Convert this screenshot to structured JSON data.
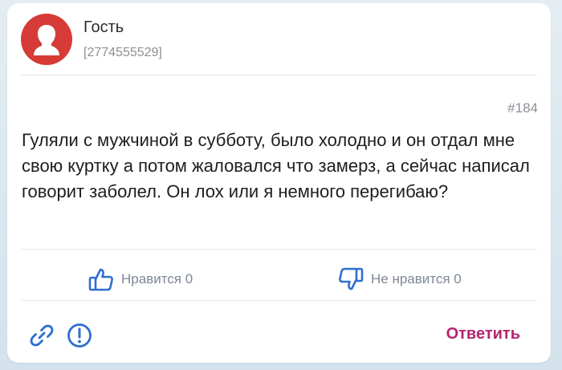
{
  "author": {
    "name": "Гость",
    "id": "[2774555529]",
    "avatar_icon": "user-silhouette-icon",
    "avatar_color": "#d63b37"
  },
  "post": {
    "number": "#184",
    "text": "Гуляли с мужчиной в субботу, было холодно и он отдал мне свою куртку а потом жаловался что замерз, а сейчас написал говорит заболел. Он лох или я немного перегибаю?"
  },
  "reactions": {
    "like_label": "Нравится 0",
    "like_icon": "thumbs-up-icon",
    "dislike_label": "Не нравится 0",
    "dislike_icon": "thumbs-down-icon",
    "icon_color": "#2e6fcf"
  },
  "footer": {
    "link_icon": "link-icon",
    "report_icon": "report-icon",
    "reply_label": "Ответить",
    "reply_color": "#b6256f"
  }
}
